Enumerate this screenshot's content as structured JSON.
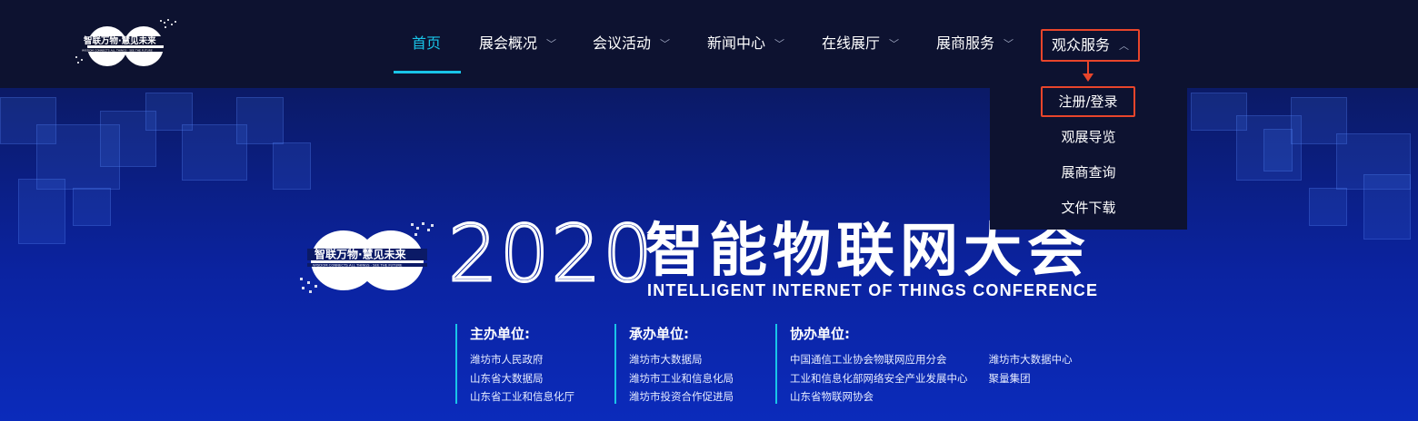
{
  "logo": {
    "cn": "智联万物·慧见未来",
    "en": "WISDOM CONNECTS ALL THINGS · SEE THE FUTURE"
  },
  "nav": {
    "items": [
      {
        "label": "首页",
        "active": true
      },
      {
        "label": "展会概况",
        "chevron": "chevron-down"
      },
      {
        "label": "会议活动",
        "chevron": "chevron-down"
      },
      {
        "label": "新闻中心",
        "chevron": "chevron-down"
      },
      {
        "label": "在线展厅",
        "chevron": "chevron-down"
      },
      {
        "label": "展商服务",
        "chevron": "chevron-down"
      },
      {
        "label": "观众服务",
        "chevron": "chevron-up",
        "highlighted": true
      }
    ],
    "dropdown": [
      "注册/登录",
      "观展导览",
      "展商查询",
      "文件下载"
    ],
    "accent_color": "#19c4e8",
    "highlight_color": "#e8452b"
  },
  "hero": {
    "year": "2020",
    "title": "智能物联网大会",
    "subtitle": "INTELLIGENT INTERNET OF THINGS CONFERENCE",
    "orgs": [
      {
        "title": "主办单位:",
        "lines": [
          "潍坊市人民政府",
          "山东省大数据局",
          "山东省工业和信息化厅"
        ]
      },
      {
        "title": "承办单位:",
        "lines": [
          "潍坊市大数据局",
          "潍坊市工业和信息化局",
          "潍坊市投资合作促进局"
        ]
      },
      {
        "title": "协办单位:",
        "lines": [
          "中国通信工业协会物联网应用分会",
          "工业和信息化部网络安全产业发展中心",
          "山东省物联网协会"
        ],
        "lines2": [
          "潍坊市大数据中心",
          "聚量集团"
        ]
      }
    ]
  }
}
